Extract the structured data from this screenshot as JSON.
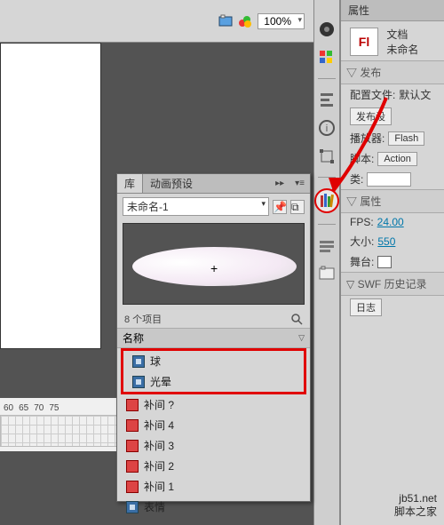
{
  "toolbar": {
    "zoom": "100%"
  },
  "timeline": {
    "frames": [
      "60",
      "65",
      "70",
      "75"
    ]
  },
  "lib_tooltip": "库",
  "panel": {
    "tabs": {
      "library": "库",
      "presets": "动画预设"
    },
    "doc": "未命名-1",
    "count": "8 个项目",
    "header": "名称",
    "items": [
      {
        "label": "球",
        "type": "mc"
      },
      {
        "label": "光晕",
        "type": "mc"
      },
      {
        "label": "补间 ?",
        "type": "tw"
      },
      {
        "label": "补间 4",
        "type": "tw"
      },
      {
        "label": "补间 3",
        "type": "tw"
      },
      {
        "label": "补间 2",
        "type": "tw"
      },
      {
        "label": "补间 1",
        "type": "tw"
      },
      {
        "label": "表情",
        "type": "mc"
      }
    ]
  },
  "props": {
    "title": "属性",
    "doc_label": "文档",
    "doc_name": "未命名",
    "publish_h": "发布",
    "profile_l": "配置文件:",
    "profile_v": "默认文",
    "pubset_btn": "发布设",
    "player_l": "播放器:",
    "player_v": "Flash",
    "script_l": "脚本:",
    "script_v": "Action",
    "class_l": "类:",
    "props_h": "属性",
    "fps_l": "FPS:",
    "fps_v": "24.00",
    "size_l": "大小:",
    "size_v": "550",
    "stage_l": "舞台:",
    "swf_h": "SWF 历史记录",
    "log_btn": "日志"
  },
  "watermark": {
    "l1": "jb51.net",
    "l2": "脚本之家"
  }
}
